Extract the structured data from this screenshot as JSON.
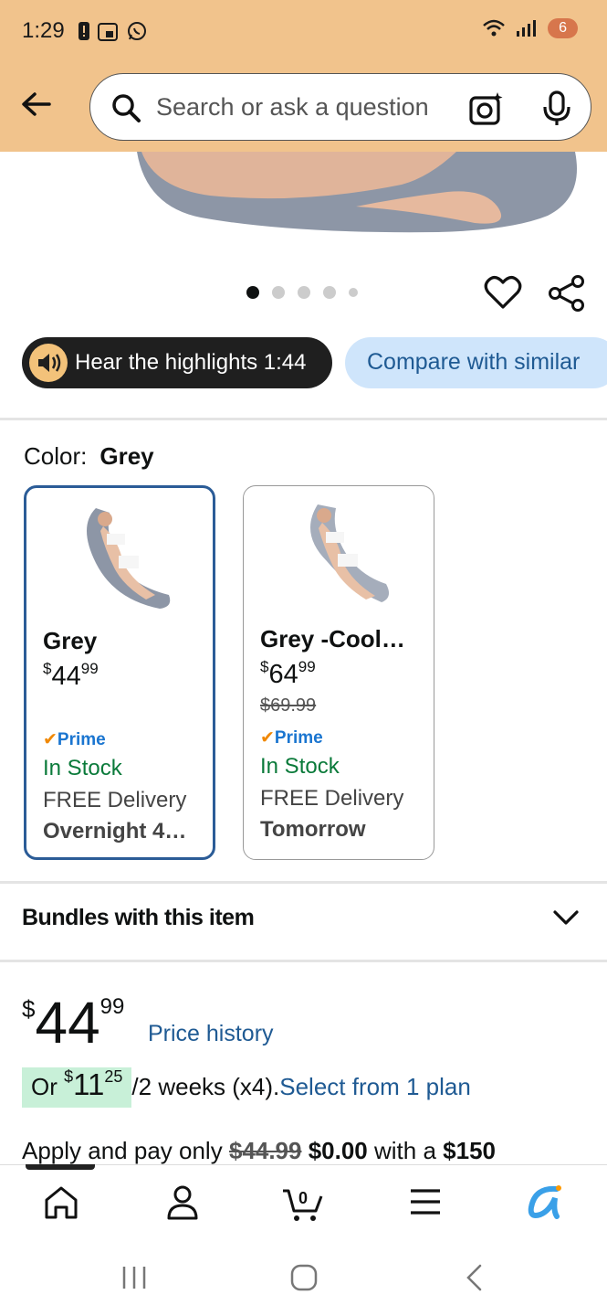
{
  "status": {
    "time": "1:29",
    "battery": "6"
  },
  "search": {
    "placeholder": "Search or ask a question"
  },
  "carousel": {
    "total": 5,
    "active": 0
  },
  "highlights": {
    "label": "Hear the highlights 1:44"
  },
  "compare": {
    "label": "Compare with similar"
  },
  "color": {
    "label": "Color:",
    "value": "Grey"
  },
  "variants": [
    {
      "name": "Grey",
      "price_whole": "44",
      "price_cents": "99",
      "currency": "$",
      "strike": "",
      "prime": "Prime",
      "stock": "In Stock",
      "delivery": "FREE Delivery",
      "delivery_when": "Overnight 4…",
      "selected": true
    },
    {
      "name": "Grey -Cool…",
      "price_whole": "64",
      "price_cents": "99",
      "currency": "$",
      "strike": "$69.99",
      "prime": "Prime",
      "stock": "In Stock",
      "delivery": "FREE Delivery",
      "delivery_when": "Tomorrow",
      "selected": false
    }
  ],
  "bundles": {
    "label": "Bundles with this item"
  },
  "price": {
    "currency": "$",
    "whole": "44",
    "cents": "99",
    "history_link": "Price history"
  },
  "installment": {
    "prefix": "Or ",
    "currency": "$",
    "amount": "11",
    "cents": "25",
    "period": "/2 weeks (x4).",
    "link": "Select from 1 plan"
  },
  "apply": {
    "text1": "Apply and pay only ",
    "strike": "$44.99",
    "now": "$0.00",
    "text2": " with a ",
    "amount": "$150"
  },
  "colors": {
    "header": "#f1c38c",
    "link": "#1f5a93",
    "stock": "#0a7a3a",
    "prime": "#1a75d0",
    "selected_border": "#2b5c97"
  }
}
